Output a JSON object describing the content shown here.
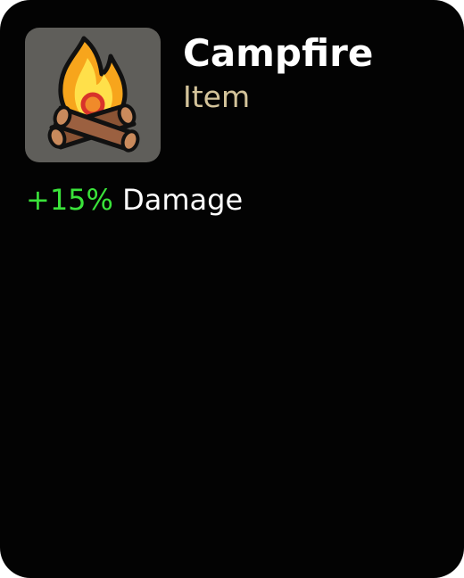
{
  "item": {
    "name": "Campfire",
    "type": "Item",
    "icon": "campfire-icon"
  },
  "stats": [
    {
      "value": "+15%",
      "label": "Damage"
    }
  ],
  "colors": {
    "background": "#030303",
    "icon_frame": "#5f5e5a",
    "name": "#ffffff",
    "type": "#d3c39a",
    "positive_value": "#3ae33a",
    "stat_label": "#ffffff"
  }
}
